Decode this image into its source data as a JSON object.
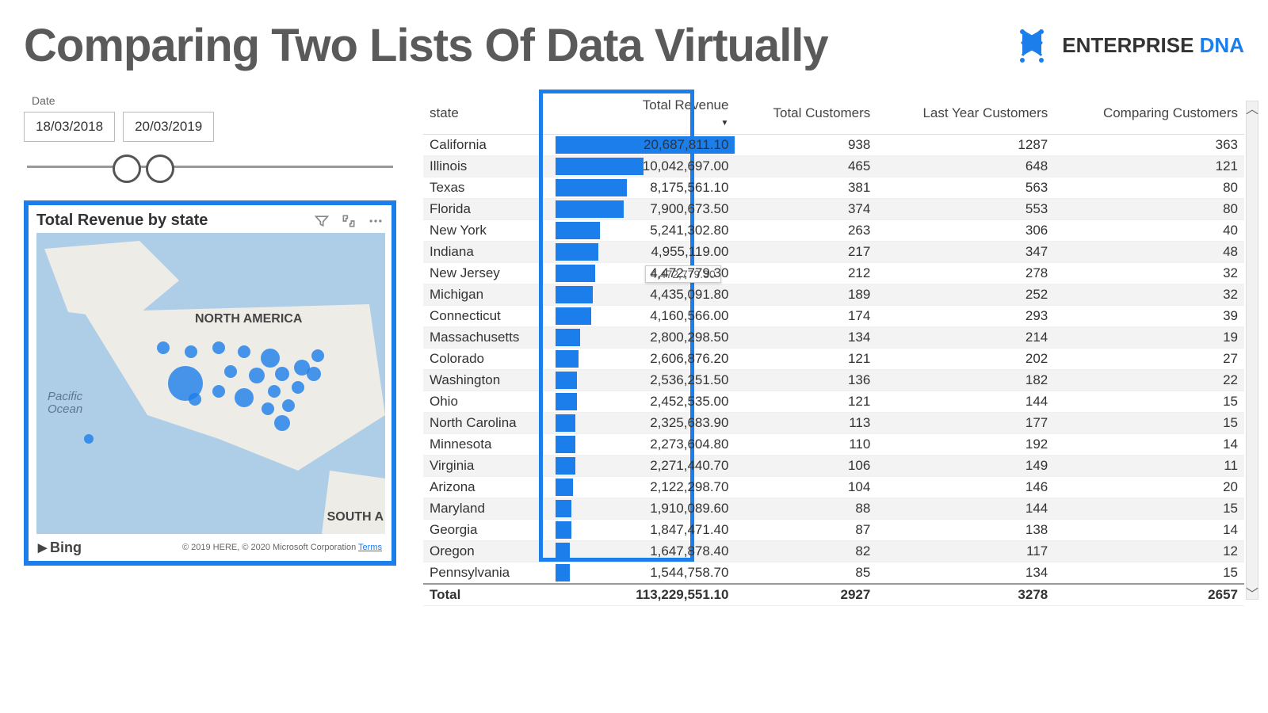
{
  "header": {
    "title": "Comparing Two Lists Of Data Virtually",
    "brand_a": "ENTERPRISE ",
    "brand_b": "DNA"
  },
  "date_slicer": {
    "label": "Date",
    "from": "18/03/2018",
    "to": "20/03/2019"
  },
  "map_card": {
    "title": "Total Revenue by state",
    "continent_label": "NORTH AMERICA",
    "south_label": "SOUTH A",
    "ocean_a": "Pacific",
    "ocean_b": "Ocean",
    "bing": "Bing",
    "copyright": "© 2019 HERE, © 2020 Microsoft Corporation",
    "terms": "Terms"
  },
  "table": {
    "headers": {
      "state": "state",
      "rev": "Total Revenue",
      "tc": "Total Customers",
      "lyc": "Last Year Customers",
      "cc": "Comparing Customers"
    },
    "rows": [
      {
        "state": "California",
        "rev": "20,687,811.10",
        "bar": 100,
        "tc": "938",
        "lyc": "1287",
        "cc": "363"
      },
      {
        "state": "Illinois",
        "rev": "10,042,697.00",
        "bar": 49,
        "tc": "465",
        "lyc": "648",
        "cc": "121"
      },
      {
        "state": "Texas",
        "rev": "8,175,561.10",
        "bar": 40,
        "tc": "381",
        "lyc": "563",
        "cc": "80"
      },
      {
        "state": "Florida",
        "rev": "7,900,673.50",
        "bar": 38,
        "tc": "374",
        "lyc": "553",
        "cc": "80"
      },
      {
        "state": "New York",
        "rev": "5,241,302.80",
        "bar": 25,
        "tc": "263",
        "lyc": "306",
        "cc": "40"
      },
      {
        "state": "Indiana",
        "rev": "4,955,119.00",
        "bar": 24,
        "tc": "217",
        "lyc": "347",
        "cc": "48"
      },
      {
        "state": "New Jersey",
        "rev": "4,472,779.30",
        "bar": 22,
        "tc": "212",
        "lyc": "278",
        "cc": "32"
      },
      {
        "state": "Michigan",
        "rev": "4,435,091.80",
        "bar": 21,
        "tc": "189",
        "lyc": "252",
        "cc": "32"
      },
      {
        "state": "Connecticut",
        "rev": "4,160,566.00",
        "bar": 20,
        "tc": "174",
        "lyc": "293",
        "cc": "39"
      },
      {
        "state": "Massachusetts",
        "rev": "2,800,298.50",
        "bar": 14,
        "tc": "134",
        "lyc": "214",
        "cc": "19"
      },
      {
        "state": "Colorado",
        "rev": "2,606,876.20",
        "bar": 13,
        "tc": "121",
        "lyc": "202",
        "cc": "27"
      },
      {
        "state": "Washington",
        "rev": "2,536,251.50",
        "bar": 12,
        "tc": "136",
        "lyc": "182",
        "cc": "22"
      },
      {
        "state": "Ohio",
        "rev": "2,452,535.00",
        "bar": 12,
        "tc": "121",
        "lyc": "144",
        "cc": "15"
      },
      {
        "state": "North Carolina",
        "rev": "2,325,683.90",
        "bar": 11,
        "tc": "113",
        "lyc": "177",
        "cc": "15"
      },
      {
        "state": "Minnesota",
        "rev": "2,273,604.80",
        "bar": 11,
        "tc": "110",
        "lyc": "192",
        "cc": "14"
      },
      {
        "state": "Virginia",
        "rev": "2,271,440.70",
        "bar": 11,
        "tc": "106",
        "lyc": "149",
        "cc": "11"
      },
      {
        "state": "Arizona",
        "rev": "2,122,298.70",
        "bar": 10,
        "tc": "104",
        "lyc": "146",
        "cc": "20"
      },
      {
        "state": "Maryland",
        "rev": "1,910,089.60",
        "bar": 9,
        "tc": "88",
        "lyc": "144",
        "cc": "15"
      },
      {
        "state": "Georgia",
        "rev": "1,847,471.40",
        "bar": 9,
        "tc": "87",
        "lyc": "138",
        "cc": "14"
      },
      {
        "state": "Oregon",
        "rev": "1,647,878.40",
        "bar": 8,
        "tc": "82",
        "lyc": "117",
        "cc": "12"
      },
      {
        "state": "Pennsylvania",
        "rev": "1,544,758.70",
        "bar": 8,
        "tc": "85",
        "lyc": "134",
        "cc": "15"
      }
    ],
    "total": {
      "label": "Total",
      "rev": "113,229,551.10",
      "tc": "2927",
      "lyc": "3278",
      "cc": "2657"
    },
    "tooltip": "4,472,779.30"
  },
  "chart_data": {
    "type": "table",
    "title": "Total Revenue by state",
    "columns": [
      "state",
      "Total Revenue",
      "Total Customers",
      "Last Year Customers",
      "Comparing Customers"
    ],
    "series": [
      {
        "name": "Total Revenue",
        "values": [
          20687811.1,
          10042697.0,
          8175561.1,
          7900673.5,
          5241302.8,
          4955119.0,
          4472779.3,
          4435091.8,
          4160566.0,
          2800298.5,
          2606876.2,
          2536251.5,
          2452535.0,
          2325683.9,
          2273604.8,
          2271440.7,
          2122298.7,
          1910089.6,
          1847471.4,
          1647878.4,
          1544758.7
        ]
      },
      {
        "name": "Total Customers",
        "values": [
          938,
          465,
          381,
          374,
          263,
          217,
          212,
          189,
          174,
          134,
          121,
          136,
          121,
          113,
          110,
          106,
          104,
          88,
          87,
          82,
          85
        ]
      },
      {
        "name": "Last Year Customers",
        "values": [
          1287,
          648,
          563,
          553,
          306,
          347,
          278,
          252,
          293,
          214,
          202,
          182,
          144,
          177,
          192,
          149,
          146,
          144,
          138,
          117,
          134
        ]
      },
      {
        "name": "Comparing Customers",
        "values": [
          363,
          121,
          80,
          80,
          40,
          48,
          32,
          32,
          39,
          19,
          27,
          22,
          15,
          15,
          14,
          11,
          20,
          15,
          14,
          12,
          15
        ]
      }
    ],
    "categories": [
      "California",
      "Illinois",
      "Texas",
      "Florida",
      "New York",
      "Indiana",
      "New Jersey",
      "Michigan",
      "Connecticut",
      "Massachusetts",
      "Colorado",
      "Washington",
      "Ohio",
      "North Carolina",
      "Minnesota",
      "Virginia",
      "Arizona",
      "Maryland",
      "Georgia",
      "Oregon",
      "Pennsylvania"
    ],
    "totals": {
      "Total Revenue": 113229551.1,
      "Total Customers": 2927,
      "Last Year Customers": 3278,
      "Comparing Customers": 2657
    }
  }
}
